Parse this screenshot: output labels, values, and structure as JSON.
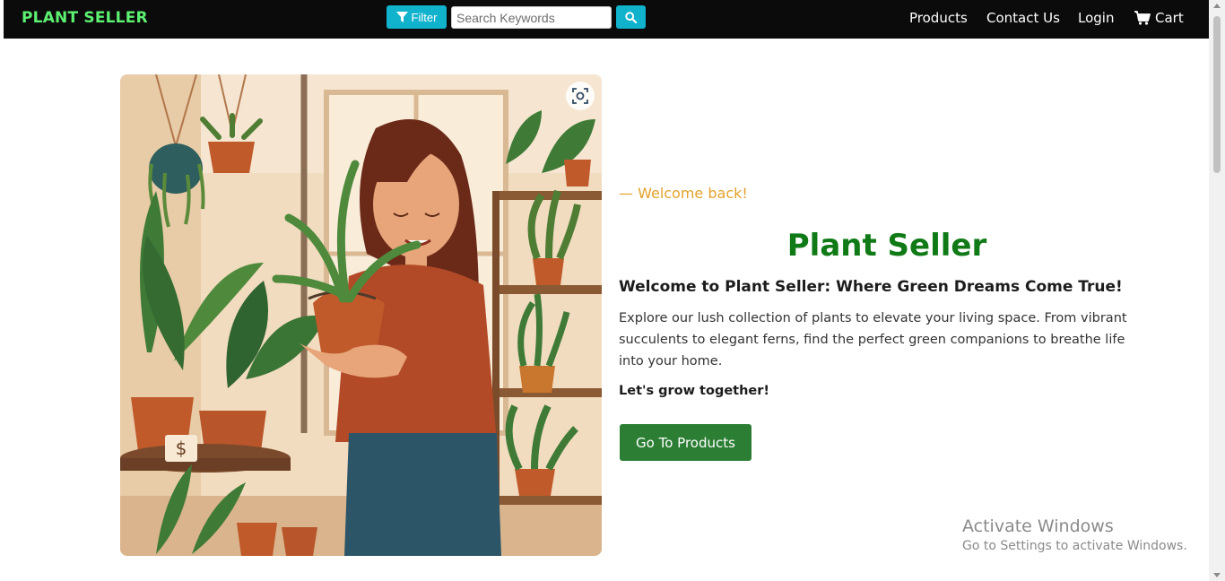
{
  "navbar": {
    "brand": "PLANT SELLER",
    "filter_label": "Filter",
    "search_placeholder": "Search Keywords",
    "search_value": "",
    "links": {
      "products": "Products",
      "contact": "Contact Us",
      "login": "Login",
      "cart": "Cart"
    },
    "background_color": "#0b0b0b",
    "brand_color": "#5df071",
    "button_color": "#10b2cc"
  },
  "hero": {
    "welcome_back": "— Welcome back!",
    "title": "Plant Seller",
    "subtitle": "Welcome to Plant Seller: Where Green Dreams Come True!",
    "description": "Explore our lush collection of plants to elevate your living space. From vibrant succulents to elegant ferns, find the perfect green companions to breathe life into your home.",
    "tagline": "Let's grow together!",
    "cta_label": "Go To Products",
    "title_color": "#0f7a16",
    "accent_color": "#e3a22c",
    "cta_color": "#2c7e34",
    "image_price_tag": "$"
  },
  "watermark": {
    "title": "Activate Windows",
    "subtitle": "Go to Settings to activate Windows."
  },
  "icons": {
    "filter": "filter-icon",
    "search": "search-icon",
    "cart": "cart-icon",
    "lens": "visual-search-icon"
  }
}
